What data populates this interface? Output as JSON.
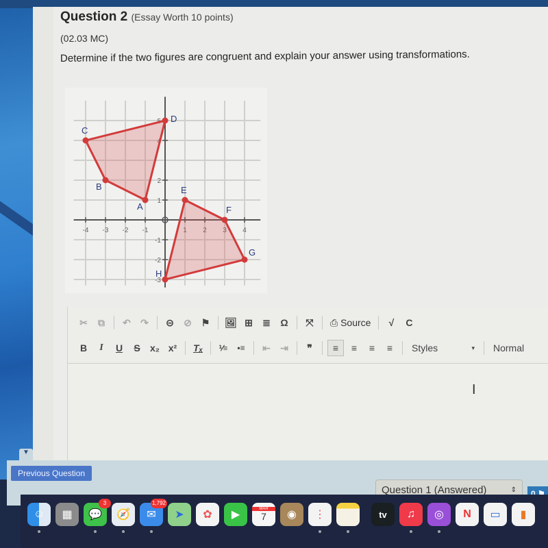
{
  "question": {
    "title": "Question 2",
    "subtitle": "(Essay Worth 10 points)",
    "code": "(02.03 MC)",
    "prompt": "Determine if the two figures are congruent and explain your answer using transformations."
  },
  "figure": {
    "x_ticks": [
      "-4",
      "-3",
      "-2",
      "-1",
      "1",
      "2",
      "3",
      "4"
    ],
    "y_ticks": [
      "-3",
      "-2",
      "-1",
      "1",
      "2",
      "4",
      "5"
    ],
    "polygon_color": "#d23b3b",
    "shapes": [
      {
        "name": "ABCD",
        "points": [
          {
            "label": "A",
            "x": -1,
            "y": 1
          },
          {
            "label": "B",
            "x": -3,
            "y": 2
          },
          {
            "label": "C",
            "x": -4,
            "y": 4
          },
          {
            "label": "D",
            "x": 0,
            "y": 5
          }
        ]
      },
      {
        "name": "EFGH",
        "points": [
          {
            "label": "E",
            "x": 1,
            "y": 1
          },
          {
            "label": "F",
            "x": 3,
            "y": 0
          },
          {
            "label": "G",
            "x": 4,
            "y": -2
          },
          {
            "label": "H",
            "x": 0,
            "y": -3
          }
        ]
      }
    ]
  },
  "toolbar": {
    "row1": {
      "cut": "✂",
      "copy": "⧉",
      "undo": "↶",
      "redo": "↷",
      "link": "⊝",
      "unlink": "⊘",
      "anchor": "⚑",
      "image": "🖼",
      "table": "⊞",
      "hr": "≣",
      "special_char": "Ω",
      "maximize": "⤧",
      "source_icon": "⎙",
      "source_label": "Source",
      "math": "√",
      "spellcheck": "C"
    },
    "row2": {
      "bold": "B",
      "italic": "I",
      "underline": "U",
      "strike": "S",
      "subscript": "x₂",
      "superscript": "x²",
      "remove_format": "Tₓ",
      "numbered_list": "⅟≡",
      "bulleted_list": "•≡",
      "outdent": "⇤",
      "indent": "⇥",
      "blockquote": "❞",
      "align_left": "≡",
      "align_center": "≡",
      "align_right": "≡",
      "justify": "≡",
      "styles_label": "Styles",
      "format_label": "Normal"
    }
  },
  "editor": {
    "value": ""
  },
  "footer": {
    "previous_label": "Previous Question",
    "question_select": "Question 1 (Answered)",
    "flag_count": "0"
  },
  "dock": {
    "messages_badge": "3",
    "mail_badge": "1,792",
    "calendar_month": "MAR",
    "calendar_day": "7",
    "tv_label": "tv"
  }
}
